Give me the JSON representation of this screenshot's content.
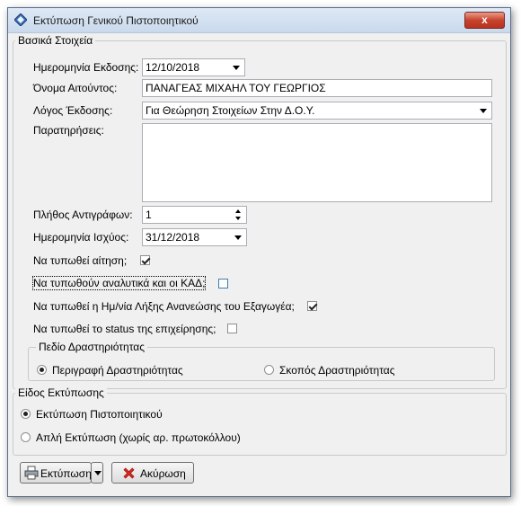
{
  "window": {
    "title": "Εκτύπωση Γενικού Πιστοποιητικού",
    "close_label": "x"
  },
  "basic": {
    "legend": "Βασικά Στοιχεία",
    "issue_date_label": "Ημερομηνία Εκδοσης:",
    "issue_date_value": "12/10/2018",
    "applicant_label": "Όνομα Αιτούντος:",
    "applicant_value": "ΠΑΝΑΓΕΑΣ ΜΙΧΑΗΛ ΤΟΥ ΓΕΩΡΓΙΟΣ",
    "reason_label": "Λόγος Έκδοσης:",
    "reason_value": "Για Θεώρηση Στοιχείων Στην Δ.Ο.Υ.",
    "notes_label": "Παρατηρήσεις:",
    "notes_value": "",
    "copies_label": "Πλήθος Αντιγράφων:",
    "copies_value": "1",
    "validity_label": "Ημερομηνία Ισχύος:",
    "validity_value": "31/12/2018",
    "print_request_label": "Να τυπωθεί αίτηση;",
    "print_request_checked": true,
    "print_kad_label": "Να τυπωθούν αναλυτικά και οι ΚΑΔ;",
    "print_kad_checked": false,
    "print_expiry_label": "Να τυπωθεί η Ημ/νία Λήξης Ανανεώσης του Εξαγωγέα;",
    "print_expiry_checked": true,
    "print_status_label": "Να τυπωθεί το status της επιχείρησης;",
    "print_status_checked": false
  },
  "activity": {
    "legend": "Πεδίο Δραστηριότητας",
    "option_description": "Περιγραφή Δραστηριότητας",
    "option_purpose": "Σκοπός Δραστηριότητας",
    "selected": "description"
  },
  "print_type": {
    "legend": "Είδος Εκτύπωσης",
    "option_certificate": "Εκτύπωση Πιστοποιητικού",
    "option_simple": "Απλή Εκτύπωση (χωρίς αρ. πρωτοκόλλου)",
    "selected": "certificate"
  },
  "buttons": {
    "print_label": "Εκτύπωση",
    "cancel_label": "Ακύρωση"
  },
  "colors": {
    "title_bar": "#c9d9ec",
    "close_button": "#c8432d",
    "cancel_icon": "#d8261b"
  }
}
